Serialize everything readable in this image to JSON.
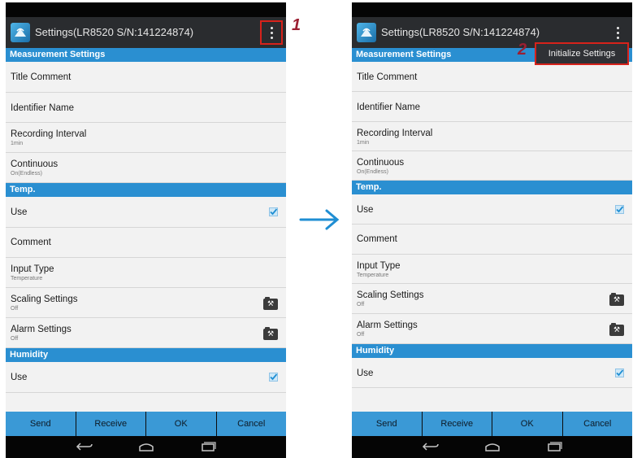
{
  "titlebar": {
    "title": "Settings(LR8520 S/N:141224874)"
  },
  "sections": {
    "measurement": "Measurement Settings",
    "temp": "Temp.",
    "humidity": "Humidity"
  },
  "rows": {
    "title_comment": "Title Comment",
    "identifier_name": "Identifier Name",
    "recording_interval": "Recording Interval",
    "recording_interval_value": "1min",
    "continuous": "Continuous",
    "continuous_value": "On(Endless)",
    "temp_use": "Use",
    "temp_comment": "Comment",
    "input_type": "Input Type",
    "input_type_value": "Temperature",
    "scaling": "Scaling Settings",
    "scaling_value": "Off",
    "alarm": "Alarm Settings",
    "alarm_value": "Off",
    "humidity_use": "Use"
  },
  "buttons": {
    "send": "Send",
    "receive": "Receive",
    "ok": "OK",
    "cancel": "Cancel"
  },
  "menu": {
    "initialize": "Initialize Settings"
  },
  "steps": {
    "one": "1",
    "two": "2"
  },
  "checkboxes": {
    "temp_use": true,
    "humidity_use": true
  },
  "icons": {
    "app": "sensor-wireless-icon",
    "overflow": "overflow-menu-icon",
    "wrench": "wrench-folder-icon",
    "nav": [
      "back-icon",
      "home-icon",
      "recent-apps-icon"
    ]
  },
  "colors": {
    "section": "#2a8fd1",
    "button": "#3a99d6",
    "highlight": "#d7221b",
    "step": "#9c1f32",
    "arrow": "#1f8ed3"
  }
}
